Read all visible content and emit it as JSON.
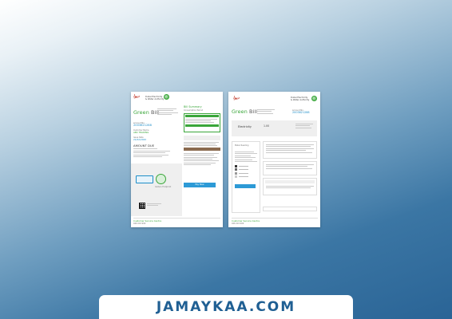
{
  "banner": {
    "text": "JAMAYKAA.COM"
  },
  "page1": {
    "logo_ar": "ديوا",
    "logo_en": "Dubai Electricity & Water Authority",
    "title_a": "Green",
    "title_b": "Bill",
    "account_label": "Account No.",
    "account_no": "2003621288",
    "customer_label": "Customer Name",
    "customer_name": "ABC TRADING",
    "issue_label": "Issue Date",
    "issue_date": "21/02/2020",
    "section_head": "AMOUNT DUE",
    "summary_title": "Bill Summary",
    "summary_sub": "Consumption Period",
    "pay_button": "Pay Now",
    "carbon_label": "Carbon Footprint",
    "footer_green": "Customer Service Centre",
    "footer_sub": "046 019 999"
  },
  "page2": {
    "logo_ar": "ديوا",
    "logo_en": "Dubai Electricity & Water Authority",
    "title_a": "Green",
    "title_b": "Bill",
    "account_label": "Account No.",
    "account_no": "2003621288",
    "section_electricity": "Electricity",
    "amount": "1.00",
    "meter_label": "Meter Reading",
    "footer_green": "Customer Service Centre",
    "footer_sub": "046 019 999"
  }
}
